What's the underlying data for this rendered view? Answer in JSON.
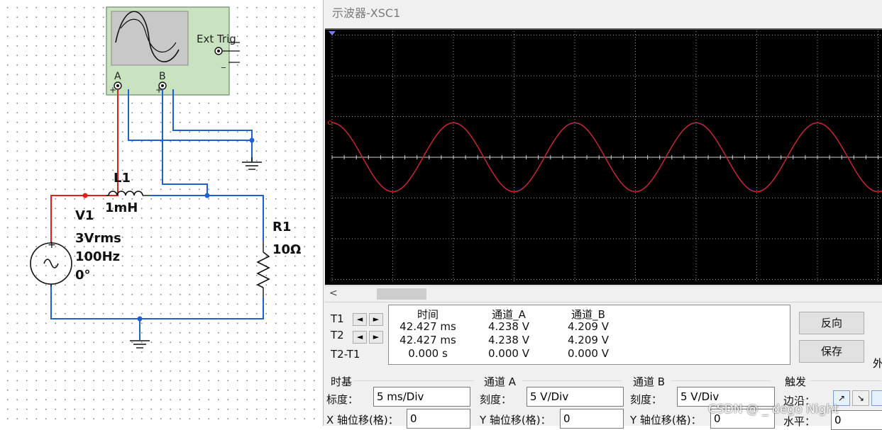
{
  "schematic": {
    "oscilloscope": {
      "ext_trig": "Ext Trig",
      "channel_a": "A",
      "channel_b": "B",
      "plus": "+",
      "minus": "_"
    },
    "inductor": {
      "name": "L1",
      "value": "1mH"
    },
    "source": {
      "name": "V1",
      "voltage": "3Vrms",
      "frequency": "100Hz",
      "phase": "0°"
    },
    "resistor": {
      "name": "R1",
      "value": "10Ω"
    },
    "wire_colors": {
      "channel_a": "#e0201b",
      "channel_b": "#1f5fd6"
    }
  },
  "window": {
    "title": "示波器-XSC1"
  },
  "screen": {
    "background": "#000000",
    "grid_color": "#9a9a9a",
    "trace_a_color": "#e0201b",
    "trace_b_color": "#3a3af0"
  },
  "chart_data": {
    "type": "line",
    "title": "",
    "xlabel": "",
    "ylabel": "",
    "time_per_div_ms": 5,
    "volts_per_div": 5,
    "divisions_x": 10,
    "divisions_y": 6,
    "series": [
      {
        "name": "通道_A",
        "amplitude_v": 4.238,
        "frequency_hz": 100,
        "phase_deg": 90
      },
      {
        "name": "通道_B",
        "amplitude_v": 4.209,
        "frequency_hz": 100,
        "phase_deg": 90
      }
    ]
  },
  "scrollbar": {
    "left_arrow": "<"
  },
  "cursors": {
    "t1_label": "T1",
    "t2_label": "T2",
    "diff_label": "T2-T1",
    "left_arrow": "◄",
    "right_arrow": "►",
    "headers": [
      "时间",
      "通道_A",
      "通道_B"
    ],
    "rows": [
      [
        "42.427 ms",
        "4.238 V",
        "4.209 V"
      ],
      [
        "42.427 ms",
        "4.238 V",
        "4.209 V"
      ],
      [
        "0.000 s",
        "0.000 V",
        "0.000 V"
      ]
    ]
  },
  "buttons": {
    "reverse": "反向",
    "save": "保存",
    "external": "外"
  },
  "timebase": {
    "title": "时基",
    "scale_label": "标度：",
    "scale_value": "5 ms/Div",
    "xpos_label": "X 轴位移(格)：",
    "xpos_value": "0"
  },
  "channel_a": {
    "title": "通道 A",
    "scale_label": "刻度：",
    "scale_value": "5  V/Div",
    "ypos_label": "Y 轴位移(格)：",
    "ypos_value": "0"
  },
  "channel_b": {
    "title": "通道 B",
    "scale_label": "刻度：",
    "scale_value": "5  V/Div",
    "ypos_label": "Y 轴位移(格)：",
    "ypos_value": "0"
  },
  "trigger": {
    "title": "触发",
    "edge_label": "边沿：",
    "level_label": "水平：",
    "level_value": "0",
    "rising_icon": "↗",
    "falling_icon": "↘"
  },
  "watermark": "CSDN @ _ dego Night"
}
